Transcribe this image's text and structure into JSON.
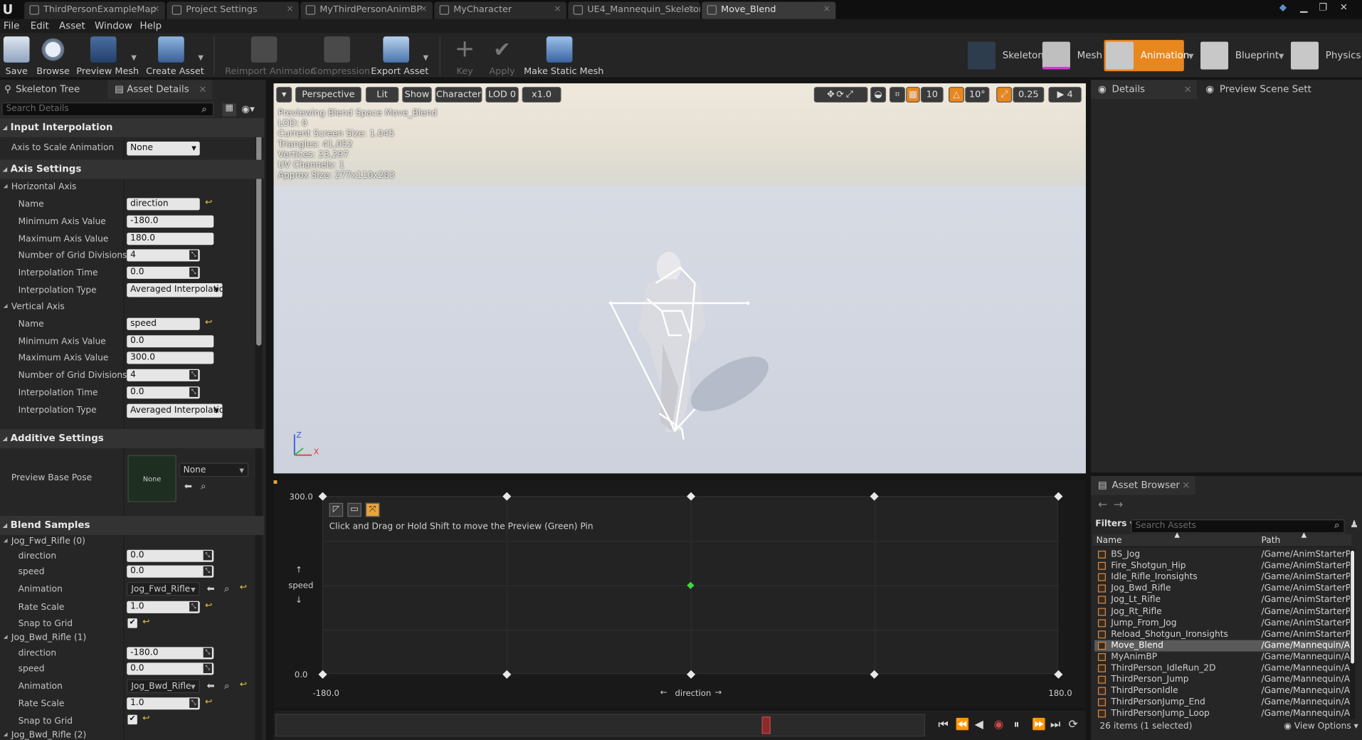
{
  "tabs": [
    {
      "label": "ThirdPersonExampleMap",
      "active": false
    },
    {
      "label": "Project Settings",
      "active": false
    },
    {
      "label": "MyThirdPersonAnimBP",
      "active": false
    },
    {
      "label": "MyCharacter",
      "active": false
    },
    {
      "label": "UE4_Mannequin_Skeleton",
      "active": false
    },
    {
      "label": "Move_Blend",
      "active": true
    }
  ],
  "menu": [
    "File",
    "Edit",
    "Asset",
    "Window",
    "Help"
  ],
  "toolbar": {
    "save": "Save",
    "browse": "Browse",
    "preview_mesh": "Preview Mesh",
    "create_asset": "Create Asset",
    "reimport": "Reimport Animation",
    "compression": "Compression",
    "export": "Export Asset",
    "key": "Key",
    "apply": "Apply",
    "make_static": "Make Static Mesh"
  },
  "modes": {
    "skeleton": "Skeleton",
    "mesh": "Mesh",
    "animation": "Animation",
    "blueprint": "Blueprint",
    "physics": "Physics"
  },
  "left_panel": {
    "tab_skeleton_tree": "Skeleton Tree",
    "tab_asset_details": "Asset Details",
    "search_placeholder": "Search Details",
    "input_interpolation": "Input Interpolation",
    "axis_to_scale_label": "Axis to Scale Animation",
    "axis_to_scale_value": "None",
    "axis_settings": "Axis Settings",
    "horizontal_axis": "Horizontal Axis",
    "vertical_axis": "Vertical Axis",
    "labels": {
      "name": "Name",
      "min": "Minimum Axis Value",
      "max": "Maximum Axis Value",
      "grid": "Number of Grid Divisions",
      "interp_time": "Interpolation Time",
      "interp_type": "Interpolation Type",
      "direction": "direction",
      "speed": "speed",
      "animation": "Animation",
      "rate_scale": "Rate Scale",
      "snap": "Snap to Grid"
    },
    "h": {
      "name": "direction",
      "min": "-180.0",
      "max": "180.0",
      "grid": "4",
      "time": "0.0",
      "type": "Averaged Interpolation"
    },
    "v": {
      "name": "speed",
      "min": "0.0",
      "max": "300.0",
      "grid": "4",
      "time": "0.0",
      "type": "Averaged Interpolation"
    },
    "additive_settings": "Additive Settings",
    "preview_base_pose": "Preview Base Pose",
    "pose_thumb": "None",
    "pose_value": "None",
    "blend_samples": "Blend Samples",
    "sample0": {
      "title": "Jog_Fwd_Rifle (0)",
      "direction": "0.0",
      "speed": "0.0",
      "anim": "Jog_Fwd_Rifle",
      "rate": "1.0"
    },
    "sample1": {
      "title": "Jog_Bwd_Rifle (1)",
      "direction": "-180.0",
      "speed": "0.0",
      "anim": "Jog_Bwd_Rifle",
      "rate": "1.0"
    },
    "sample2_title": "Jog_Bwd_Rifle (2)"
  },
  "viewport": {
    "perspective": "Perspective",
    "lit": "Lit",
    "show": "Show",
    "character": "Character",
    "lod": "LOD 0",
    "speed": "x1.0",
    "grid_snap": "10",
    "rot_snap": "10°",
    "scale_snap": "0.25",
    "cam_speed": "4",
    "info": [
      "Previewing Blend Space Move_Blend",
      "LOD: 0",
      "Current Screen Size: 1.045",
      "Triangles: 41,052",
      "Vertices: 23,297",
      "UV Channels: 1",
      "Approx Size: 277x110x283"
    ]
  },
  "blend_space": {
    "hint": "Click and Drag or Hold Shift to move the Preview (Green) Pin",
    "y_max": "300.0",
    "y_min": "0.0",
    "x_min": "-180.0",
    "x_max": "180.0",
    "x_label": "direction",
    "y_label": "speed",
    "preview_pin": {
      "direction": 0,
      "speed": 150
    }
  },
  "details_panel": {
    "tab_details": "Details",
    "tab_preview": "Preview Scene Sett"
  },
  "asset_browser": {
    "tab": "Asset Browser",
    "filters": "Filters",
    "search_placeholder": "Search Assets",
    "col_name": "Name",
    "col_path": "Path",
    "items": [
      {
        "name": "BS_Jog",
        "path": "/Game/AnimStarterP"
      },
      {
        "name": "Fire_Shotgun_Hip",
        "path": "/Game/AnimStarterP"
      },
      {
        "name": "Idle_Rifle_Ironsights",
        "path": "/Game/AnimStarterP"
      },
      {
        "name": "Jog_Bwd_Rifle",
        "path": "/Game/AnimStarterP"
      },
      {
        "name": "Jog_Lt_Rifle",
        "path": "/Game/AnimStarterP"
      },
      {
        "name": "Jog_Rt_Rifle",
        "path": "/Game/AnimStarterP"
      },
      {
        "name": "Jump_From_Jog",
        "path": "/Game/AnimStarterP"
      },
      {
        "name": "Reload_Shotgun_Ironsights",
        "path": "/Game/AnimStarterP"
      },
      {
        "name": "Move_Blend",
        "path": "/Game/Mannequin/A"
      },
      {
        "name": "MyAnimBP",
        "path": "/Game/Mannequin/A"
      },
      {
        "name": "ThirdPerson_IdleRun_2D",
        "path": "/Game/Mannequin/A"
      },
      {
        "name": "ThirdPerson_Jump",
        "path": "/Game/Mannequin/A"
      },
      {
        "name": "ThirdPersonIdle",
        "path": "/Game/Mannequin/A"
      },
      {
        "name": "ThirdPersonJump_End",
        "path": "/Game/Mannequin/A"
      },
      {
        "name": "ThirdPersonJump_Loop",
        "path": "/Game/Mannequin/A"
      }
    ],
    "selected_index": 8,
    "footer_count": "26 items (1 selected)",
    "view_options": "View Options"
  }
}
